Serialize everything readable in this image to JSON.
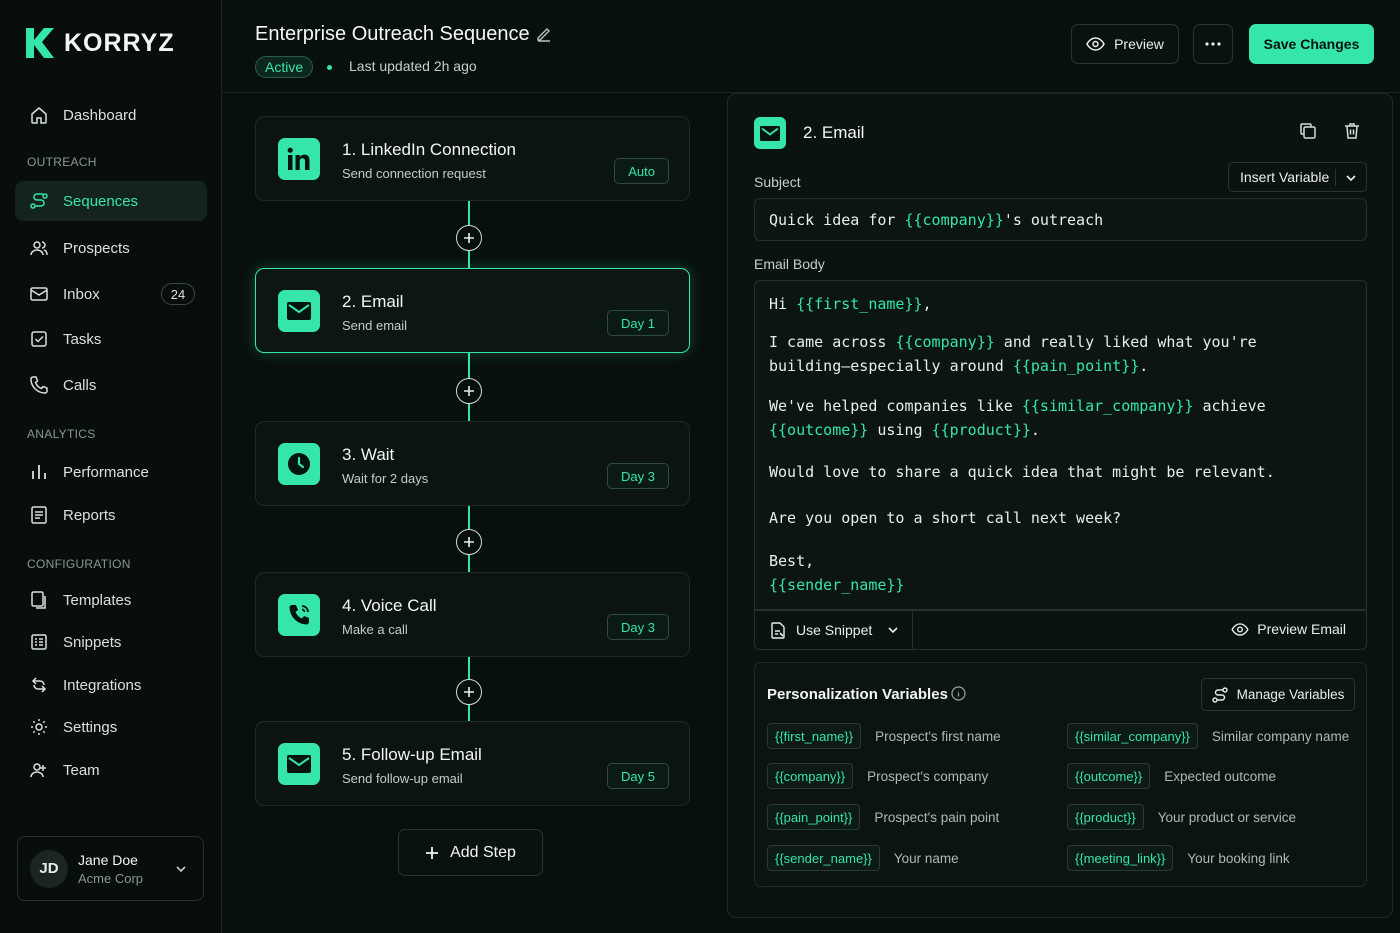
{
  "brand": {
    "name": "KORRYZ",
    "accent": "#36e6a8"
  },
  "sidebar": {
    "dashboard": "Dashboard",
    "sections": {
      "outreach": "OUTREACH",
      "analytics": "ANALYTICS",
      "configuration": "CONFIGURATION"
    },
    "items": {
      "sequences": "Sequences",
      "prospects": "Prospects",
      "inbox": "Inbox",
      "inbox_count": "24",
      "tasks": "Tasks",
      "calls": "Calls",
      "performance": "Performance",
      "reports": "Reports",
      "templates": "Templates",
      "snippets": "Snippets",
      "integrations": "Integrations",
      "settings": "Settings",
      "team": "Team"
    },
    "user": {
      "initials": "JD",
      "name": "Jane Doe",
      "org": "Acme Corp"
    }
  },
  "header": {
    "title": "Enterprise Outreach Sequence",
    "status": "Active",
    "updated": "Last updated 2h ago",
    "preview_label": "Preview",
    "save_label": "Save Changes"
  },
  "steps": [
    {
      "title": "1. LinkedIn Connection",
      "subtitle": "Send connection request",
      "badge": "Auto",
      "icon": "linkedin-icon"
    },
    {
      "title": "2. Email",
      "subtitle": "Send email",
      "badge": "Day 1",
      "icon": "mail-icon"
    },
    {
      "title": "3. Wait",
      "subtitle": "Wait for 2 days",
      "badge": "Day 3",
      "icon": "clock-icon"
    },
    {
      "title": "4. Voice Call",
      "subtitle": "Make a call",
      "badge": "Day 3",
      "icon": "phone-icon"
    },
    {
      "title": "5. Follow-up Email",
      "subtitle": "Send follow-up email",
      "badge": "Day 5",
      "icon": "mail-icon"
    }
  ],
  "add_step_label": "Add Step",
  "editor": {
    "title": "2. Email",
    "subject_label": "Subject",
    "insert_variable": "Insert Variable",
    "subject": {
      "before": "Quick idea for ",
      "var": "{{company}}",
      "after": "'s outreach"
    },
    "body_label": "Email Body",
    "body": {
      "l1_a": "Hi ",
      "l1_var": "{{first_name}}",
      "l1_b": ",",
      "l2_a": "I came across ",
      "l2_var": "{{company}}",
      "l2_b": " and really liked what you're",
      "l3_a": "building—especially around ",
      "l3_var": "{{pain_point}}",
      "l3_b": ".",
      "l4_a": "We've helped companies like ",
      "l4_var": "{{similar_company}}",
      "l4_b": " achieve",
      "l5_var": "{{outcome}}",
      "l5_a": " using ",
      "l5_var2": "{{product}}",
      "l5_b": ".",
      "l6": "Would love to share a quick idea that might be relevant.",
      "l7": "Are you open to a short call next week?",
      "l8": "Best,",
      "l9_var": "{{sender_name}}"
    },
    "use_snippet": "Use Snippet",
    "preview_email": "Preview Email",
    "vars_title": "Personalization Variables",
    "manage_vars": "Manage Variables",
    "variables": [
      {
        "token": "{{first_name}}",
        "desc": "Prospect's first name"
      },
      {
        "token": "{{similar_company}}",
        "desc": "Similar company name"
      },
      {
        "token": "{{company}}",
        "desc": "Prospect's company"
      },
      {
        "token": "{{outcome}}",
        "desc": "Expected outcome"
      },
      {
        "token": "{{pain_point}}",
        "desc": "Prospect's pain point"
      },
      {
        "token": "{{product}}",
        "desc": "Your product or service"
      },
      {
        "token": "{{sender_name}}",
        "desc": "Your name"
      },
      {
        "token": "{{meeting_link}}",
        "desc": "Your booking link"
      }
    ]
  }
}
